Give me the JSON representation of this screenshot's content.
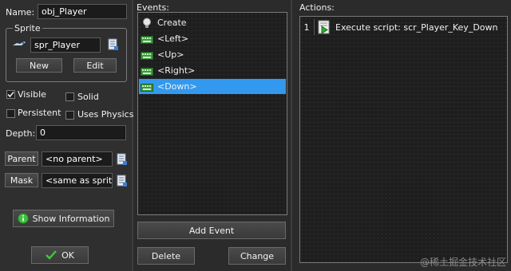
{
  "window": {
    "name_label": "Name:",
    "name_value": "obj_Player"
  },
  "sprite": {
    "group_title": "Sprite",
    "value": "spr_Player",
    "new_label": "New",
    "edit_label": "Edit"
  },
  "options": {
    "visible": {
      "label": "Visible",
      "checked": true
    },
    "solid": {
      "label": "Solid",
      "checked": false
    },
    "persistent": {
      "label": "Persistent",
      "checked": false
    },
    "uses_physics": {
      "label": "Uses Physics",
      "checked": false
    }
  },
  "depth": {
    "label": "Depth:",
    "value": "0"
  },
  "parent": {
    "label": "Parent",
    "value": "<no parent>"
  },
  "mask": {
    "label": "Mask",
    "value": "<same as sprite>"
  },
  "buttons": {
    "show_information": "Show Information",
    "ok": "OK"
  },
  "events": {
    "title": "Events:",
    "items": [
      {
        "label": "Create",
        "icon": "lightbulb-icon",
        "selected": false
      },
      {
        "label": "<Left>",
        "icon": "keyboard-icon",
        "selected": false
      },
      {
        "label": "<Up>",
        "icon": "keyboard-icon",
        "selected": false
      },
      {
        "label": "<Right>",
        "icon": "keyboard-icon",
        "selected": false
      },
      {
        "label": "<Down>",
        "icon": "keyboard-icon",
        "selected": true
      }
    ],
    "add_event": "Add Event",
    "delete": "Delete",
    "change": "Change"
  },
  "actions": {
    "title": "Actions:",
    "items": [
      {
        "index": "1",
        "label": "Execute script: scr_Player_Key_Down",
        "icon": "script-icon"
      }
    ]
  },
  "watermark": "@稀土掘金技术社区",
  "colors": {
    "background": "#2f2f2f",
    "selection": "#3399ee",
    "ok_check": "#3cc93c",
    "info_icon": "#3fbf3f"
  }
}
